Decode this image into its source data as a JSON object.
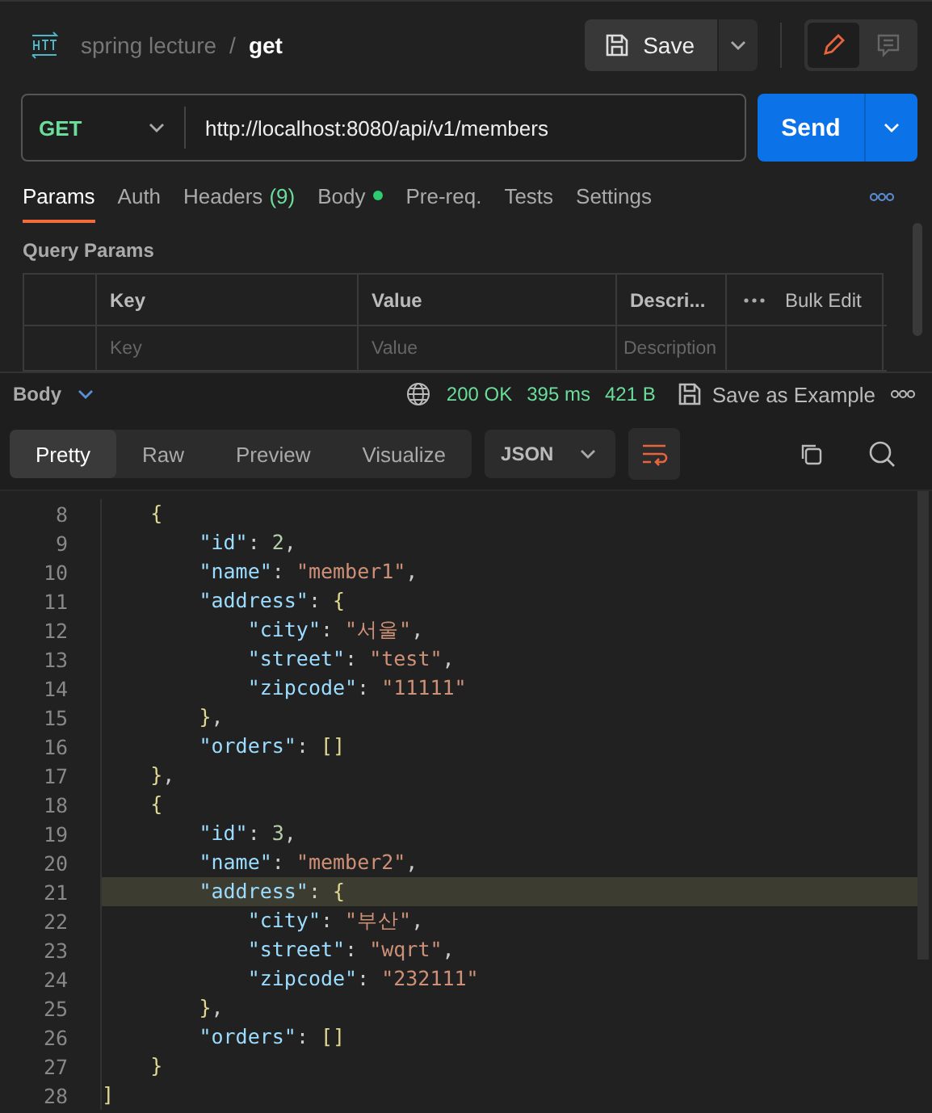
{
  "header": {
    "collection": "spring lecture",
    "separator": "/",
    "request_name": "get",
    "save_label": "Save",
    "modes": [
      {
        "kind": "edit",
        "selected": true
      },
      {
        "kind": "comment",
        "selected": false
      }
    ]
  },
  "request": {
    "method": "GET",
    "url": "http://localhost:8080/api/v1/members",
    "send_label": "Send"
  },
  "tabs": [
    {
      "label": "Params",
      "selected": true
    },
    {
      "label": "Auth",
      "selected": false
    },
    {
      "label": "Headers",
      "count": "(9)",
      "selected": false
    },
    {
      "label": "Body",
      "dot": true,
      "selected": false
    },
    {
      "label": "Pre-req.",
      "selected": false
    },
    {
      "label": "Tests",
      "selected": false
    },
    {
      "label": "Settings",
      "selected": false
    }
  ],
  "query_params": {
    "title": "Query Params",
    "columns": [
      "Key",
      "Value",
      "Descri..."
    ],
    "bulk_edit": "Bulk Edit",
    "placeholders": [
      "Key",
      "Value",
      "Description"
    ]
  },
  "response": {
    "section": "Body",
    "status": "200 OK",
    "time": "395 ms",
    "size": "421 B",
    "save_example": "Save as Example"
  },
  "view_tabs": [
    {
      "label": "Pretty",
      "selected": true
    },
    {
      "label": "Raw",
      "selected": false
    },
    {
      "label": "Preview",
      "selected": false
    },
    {
      "label": "Visualize",
      "selected": false
    }
  ],
  "format": "JSON",
  "code_lines": [
    {
      "number": "8",
      "text": "    {",
      "highlighted": false
    },
    {
      "number": "9",
      "text": "        \"id\": 2,",
      "highlighted": false
    },
    {
      "number": "10",
      "text": "        \"name\": \"member1\",",
      "highlighted": false
    },
    {
      "number": "11",
      "text": "        \"address\": {",
      "highlighted": false
    },
    {
      "number": "12",
      "text": "            \"city\": \"서울\",",
      "highlighted": false
    },
    {
      "number": "13",
      "text": "            \"street\": \"test\",",
      "highlighted": false
    },
    {
      "number": "14",
      "text": "            \"zipcode\": \"11111\"",
      "highlighted": false
    },
    {
      "number": "15",
      "text": "        },",
      "highlighted": false
    },
    {
      "number": "16",
      "text": "        \"orders\": []",
      "highlighted": false
    },
    {
      "number": "17",
      "text": "    },",
      "highlighted": false
    },
    {
      "number": "18",
      "text": "    {",
      "highlighted": false
    },
    {
      "number": "19",
      "text": "        \"id\": 3,",
      "highlighted": false
    },
    {
      "number": "20",
      "text": "        \"name\": \"member2\",",
      "highlighted": false
    },
    {
      "number": "21",
      "text": "        \"address\": {",
      "highlighted": true
    },
    {
      "number": "22",
      "text": "            \"city\": \"부산\",",
      "highlighted": false
    },
    {
      "number": "23",
      "text": "            \"street\": \"wqrt\",",
      "highlighted": false
    },
    {
      "number": "24",
      "text": "            \"zipcode\": \"232111\"",
      "highlighted": false
    },
    {
      "number": "25",
      "text": "        },",
      "highlighted": false
    },
    {
      "number": "26",
      "text": "        \"orders\": []",
      "highlighted": false
    },
    {
      "number": "27",
      "text": "    }",
      "highlighted": false
    },
    {
      "number": "28",
      "text": "]",
      "highlighted": false
    }
  ]
}
